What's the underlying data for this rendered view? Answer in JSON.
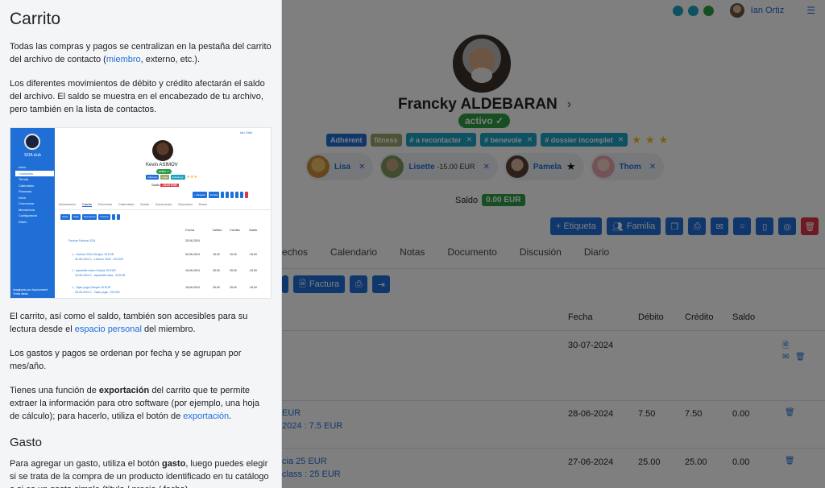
{
  "topbar": {
    "user_label": "Ian Ortiz",
    "menu_label": "☰",
    "dot_colors": [
      "#1aa2c4",
      "#1aa2c4",
      "#2e9c45"
    ]
  },
  "contact": {
    "name": "Francky ALDEBARAN",
    "status": "activo ✓",
    "tags": [
      {
        "label": "Adhérent",
        "color": "#1e6fd9",
        "removable": false
      },
      {
        "label": "fitness",
        "color": "#9aa86a",
        "removable": false
      },
      {
        "label": "# a recontacter",
        "color": "#1aa2c4",
        "removable": true
      },
      {
        "label": "# benevole",
        "color": "#1aa2c4",
        "removable": true
      },
      {
        "label": "# dossier incomplet",
        "color": "#1aa2c4",
        "removable": true
      }
    ],
    "stars": 3,
    "relations": [
      {
        "name": "Lisa",
        "amount": "",
        "color": "#f1c06a"
      },
      {
        "name": "Lisette",
        "amount": "-15.00 EUR",
        "color": "#7a9b5a"
      },
      {
        "name": "Pamela",
        "amount": "",
        "color": "#7b5a4a",
        "starred": true
      },
      {
        "name": "Thom",
        "amount": "",
        "color": "#e6a7b0"
      }
    ],
    "saldo_label": "Saldo",
    "saldo_value": "0.00 EUR"
  },
  "actions": {
    "etiqueta": "+ Etiqueta",
    "familia": "Familia"
  },
  "tabs": [
    "echos",
    "Calendario",
    "Notas",
    "Documento",
    "Discusión",
    "Diario"
  ],
  "subactions": {
    "factura": "Factura"
  },
  "table": {
    "headers": {
      "fecha": "Fecha",
      "debito": "Débito",
      "credito": "Crédito",
      "saldo": "Saldo"
    },
    "rows": [
      {
        "line1": "",
        "line2": "",
        "fecha": "30-07-2024",
        "debito": "",
        "credito": "",
        "saldo": ""
      },
      {
        "line1": "EUR",
        "line2": "2024 : 7.5 EUR",
        "fecha": "28-06-2024",
        "debito": "7.50",
        "credito": "7.50",
        "saldo": "0.00"
      },
      {
        "line1": "cia 25 EUR",
        "line2": "class : 25 EUR",
        "fecha": "27-06-2024",
        "debito": "25.00",
        "credito": "25.00",
        "saldo": "0.00"
      }
    ]
  },
  "help": {
    "title": "Carrito",
    "p1_a": "Todas las compras y pagos se centralizan en la pestaña del carrito del archivo de contacto (",
    "p1_link": "miembro",
    "p1_b": ", externo, etc.).",
    "p2": "Los diferentes movimientos de débito y crédito afectarán el saldo del archivo. El saldo se muestra en el encabezado de tu archivo, pero también en la lista de contactos.",
    "p3_a": "El carrito, así como el saldo, también son accesibles para su lectura desde el ",
    "p3_link": "espacio personal",
    "p3_b": " del miembro.",
    "p4": "Los gastos y pagos se ordenan por fecha y se agrupan por mes/año.",
    "p5_a": "Tienes una función de ",
    "p5_bold": "exportación",
    "p5_b": " del carrito que te permite extraer la información para otro software (por ejemplo, una hoja de cálculo); para hacerlo, utiliza el botón de ",
    "p5_link": "exportación",
    "p5_c": ".",
    "h_gasto": "Gasto",
    "p6_a": "Para agregar un gasto, utiliza el botón ",
    "p6_bold": "gasto",
    "p6_b": ", luego puedes elegir si se trata de la compra de un producto identificado en tu catálogo o si es un gasto simple (título / precio / fecha)."
  },
  "mini": {
    "club": "SOA club",
    "nav": [
      "Inicio",
      "Contactos",
      "Tienda",
      "Calendario",
      "Finanzas",
      "Drive",
      "Comunicar",
      "Membresía",
      "Configurador",
      "Diario"
    ],
    "footer": "Imaginado por Assoconnect\nTemis Ideas",
    "user": "Ian Ortiz",
    "name": "Kevin ASIMOV",
    "status": "activo ✓",
    "tags": [
      "Adhérent",
      "yoga",
      "Entraineur"
    ],
    "saldo_label": "Saldo",
    "saldo_value": "-15.00 EUR",
    "btns": [
      "+ Etiqueta",
      "Familia"
    ],
    "tabs": [
      "Información",
      "Carrito",
      "Derechos",
      "Calendario",
      "Notas",
      "Documento",
      "Discusión",
      "Diario"
    ],
    "sub": [
      "Gasto",
      "Pago",
      "Descuento",
      "Factura"
    ],
    "head": [
      "Fecha",
      "Débito",
      "Crédito",
      "Saldo"
    ],
    "rows": [
      {
        "a": "Factura Factura 2024",
        "b": "",
        "fecha": "25-06-2024",
        "deb": "",
        "cre": "",
        "sal": ""
      },
      {
        "a": "1 - Licence 2024 Cheque 15 EUR",
        "b": "30-06-2024 1 - Licence 2024 : 15 EUR",
        "fecha": "30-06-2024",
        "deb": "15.00",
        "cre": "15.00",
        "sal": "-15.00"
      },
      {
        "a": "1 - aquarelle class Cheque 25 EUR",
        "b": "18-06-2024 1 - aquarelle class : 25 EUR",
        "fecha": "18-06-2024",
        "deb": "25.00",
        "cre": "25.00",
        "sal": "-15.00"
      },
      {
        "a": "1 - Tapis yoga Cheque 25 EUR",
        "b": "18-06-2024 1 - Tapis yoga : 25 EUR",
        "fecha": "18-06-2024",
        "deb": "25.00",
        "cre": "25.00",
        "sal": "-15.00"
      }
    ]
  }
}
